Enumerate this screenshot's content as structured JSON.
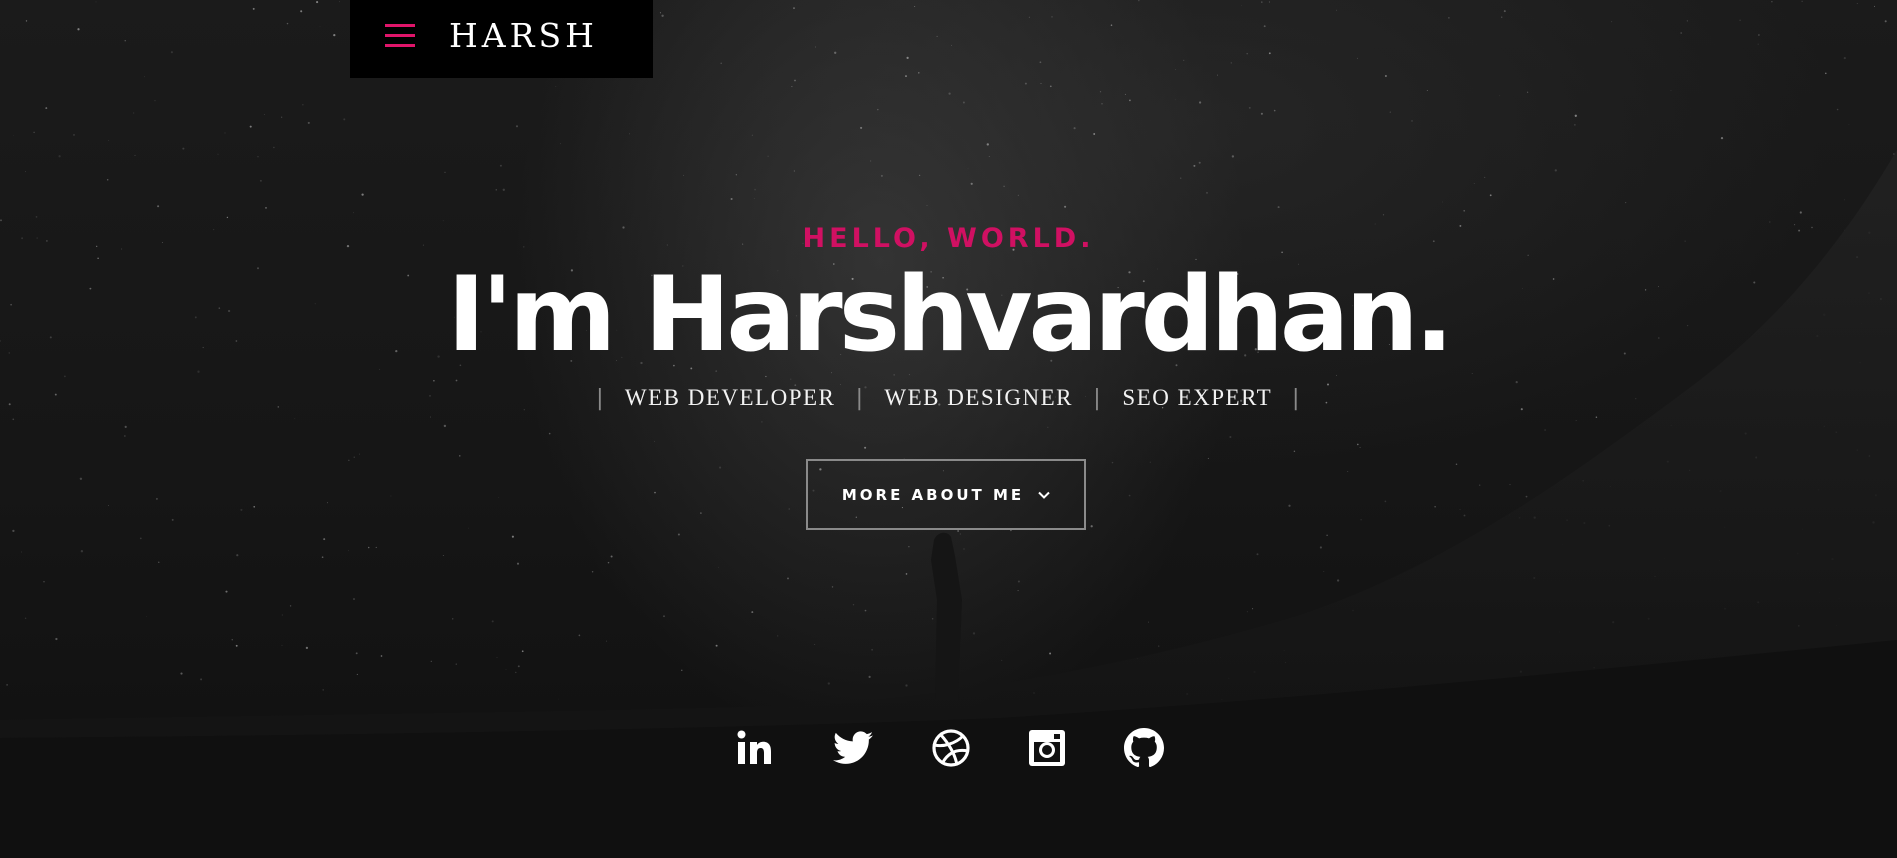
{
  "header": {
    "logo": "HARSH",
    "menu_icon": "hamburger-menu-icon",
    "accent_color": "#e0156a"
  },
  "intro": {
    "greeting": "HELLO, WORLD.",
    "headline": "I'm Harshvardhan.",
    "roles": [
      "WEB DEVELOPER",
      "WEB DESIGNER",
      "SEO EXPERT"
    ],
    "cta_label": "MORE ABOUT ME",
    "cta_icon": "chevron-down-icon"
  },
  "social_icons": [
    "linkedin-icon",
    "twitter-icon",
    "dribbble-icon",
    "instagram-icon",
    "github-icon"
  ]
}
